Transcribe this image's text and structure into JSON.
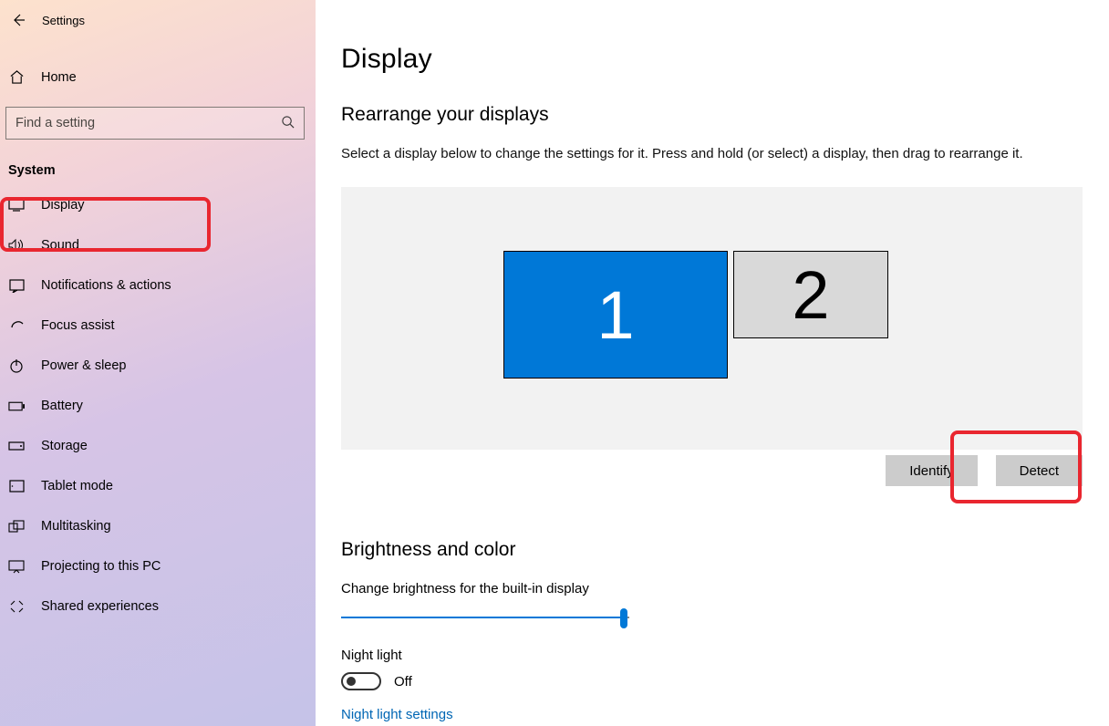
{
  "titlebar": {
    "title": "Settings"
  },
  "nav": {
    "home": "Home",
    "search_placeholder": "Find a setting",
    "section": "System",
    "items": [
      {
        "icon": "display",
        "label": "Display"
      },
      {
        "icon": "sound",
        "label": "Sound"
      },
      {
        "icon": "notifications",
        "label": "Notifications & actions"
      },
      {
        "icon": "focus",
        "label": "Focus assist"
      },
      {
        "icon": "power",
        "label": "Power & sleep"
      },
      {
        "icon": "battery",
        "label": "Battery"
      },
      {
        "icon": "storage",
        "label": "Storage"
      },
      {
        "icon": "tablet",
        "label": "Tablet mode"
      },
      {
        "icon": "multitask",
        "label": "Multitasking"
      },
      {
        "icon": "project",
        "label": "Projecting to this PC"
      },
      {
        "icon": "shared",
        "label": "Shared experiences"
      }
    ]
  },
  "main": {
    "title": "Display",
    "rearrange_heading": "Rearrange your displays",
    "rearrange_helper": "Select a display below to change the settings for it. Press and hold (or select) a display, then drag to rearrange it.",
    "monitors": {
      "primary": "1",
      "secondary": "2"
    },
    "identify_label": "Identify",
    "detect_label": "Detect",
    "brightness_heading": "Brightness and color",
    "brightness_label": "Change brightness for the built-in display",
    "night_light_label": "Night light",
    "toggle_state": "Off",
    "night_light_link": "Night light settings"
  }
}
